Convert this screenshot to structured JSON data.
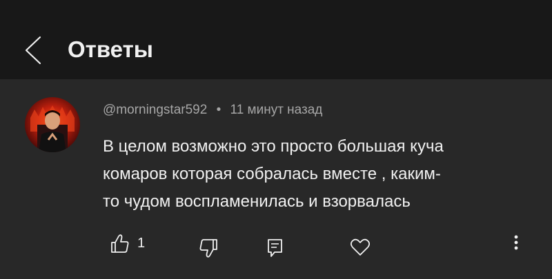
{
  "header": {
    "title": "Ответы",
    "back_icon": "chevron-left-icon"
  },
  "comment": {
    "author": "@morningstar592",
    "separator": "•",
    "time": "11 минут назад",
    "text_lines": [
      "В целом возможно это просто большая куча",
      "комаров которая собралась вместе , каким-",
      "то чудом воспламенилась и взорвалась"
    ],
    "like_count": "1",
    "icons": [
      "thumb-up-icon",
      "thumb-down-icon",
      "reply-icon",
      "heart-icon",
      "more-vertical-icon"
    ]
  },
  "colors": {
    "header_bg": "#181818",
    "body_bg": "#282828",
    "text_primary": "#f1f1f1",
    "text_secondary": "#a6a6a6"
  }
}
